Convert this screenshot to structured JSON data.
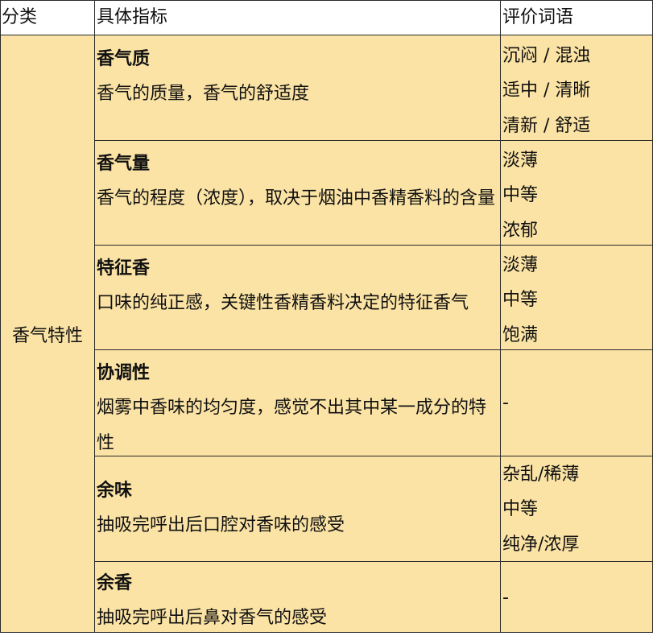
{
  "header": {
    "category": "分类",
    "indicator": "具体指标",
    "terms": "评价词语"
  },
  "category_label": "香气特性",
  "rows": [
    {
      "name": "香气质",
      "desc": "香气的质量，香气的舒适度",
      "terms": [
        "沉闷 / 混浊",
        "适中 / 清晰",
        "清新 / 舒适"
      ]
    },
    {
      "name": "香气量",
      "desc": "香气的程度（浓度），取决于烟油中香精香料的含量",
      "terms": [
        "淡薄",
        "中等",
        "浓郁"
      ]
    },
    {
      "name": "特征香",
      "desc": "口味的纯正感，关键性香精香料决定的特征香气",
      "terms": [
        "淡薄",
        "中等",
        "饱满"
      ]
    },
    {
      "name": "协调性",
      "desc": "烟雾中香味的均匀度，感觉不出其中某一成分的特性",
      "terms": [
        "-"
      ]
    },
    {
      "name": "余味",
      "desc": "抽吸完呼出后口腔对香味的感受",
      "terms": [
        "杂乱/稀薄",
        "中等",
        "纯净/浓厚"
      ]
    },
    {
      "name": "余香",
      "desc": "抽吸完呼出后鼻对香气的感受",
      "terms": [
        "-"
      ]
    }
  ]
}
